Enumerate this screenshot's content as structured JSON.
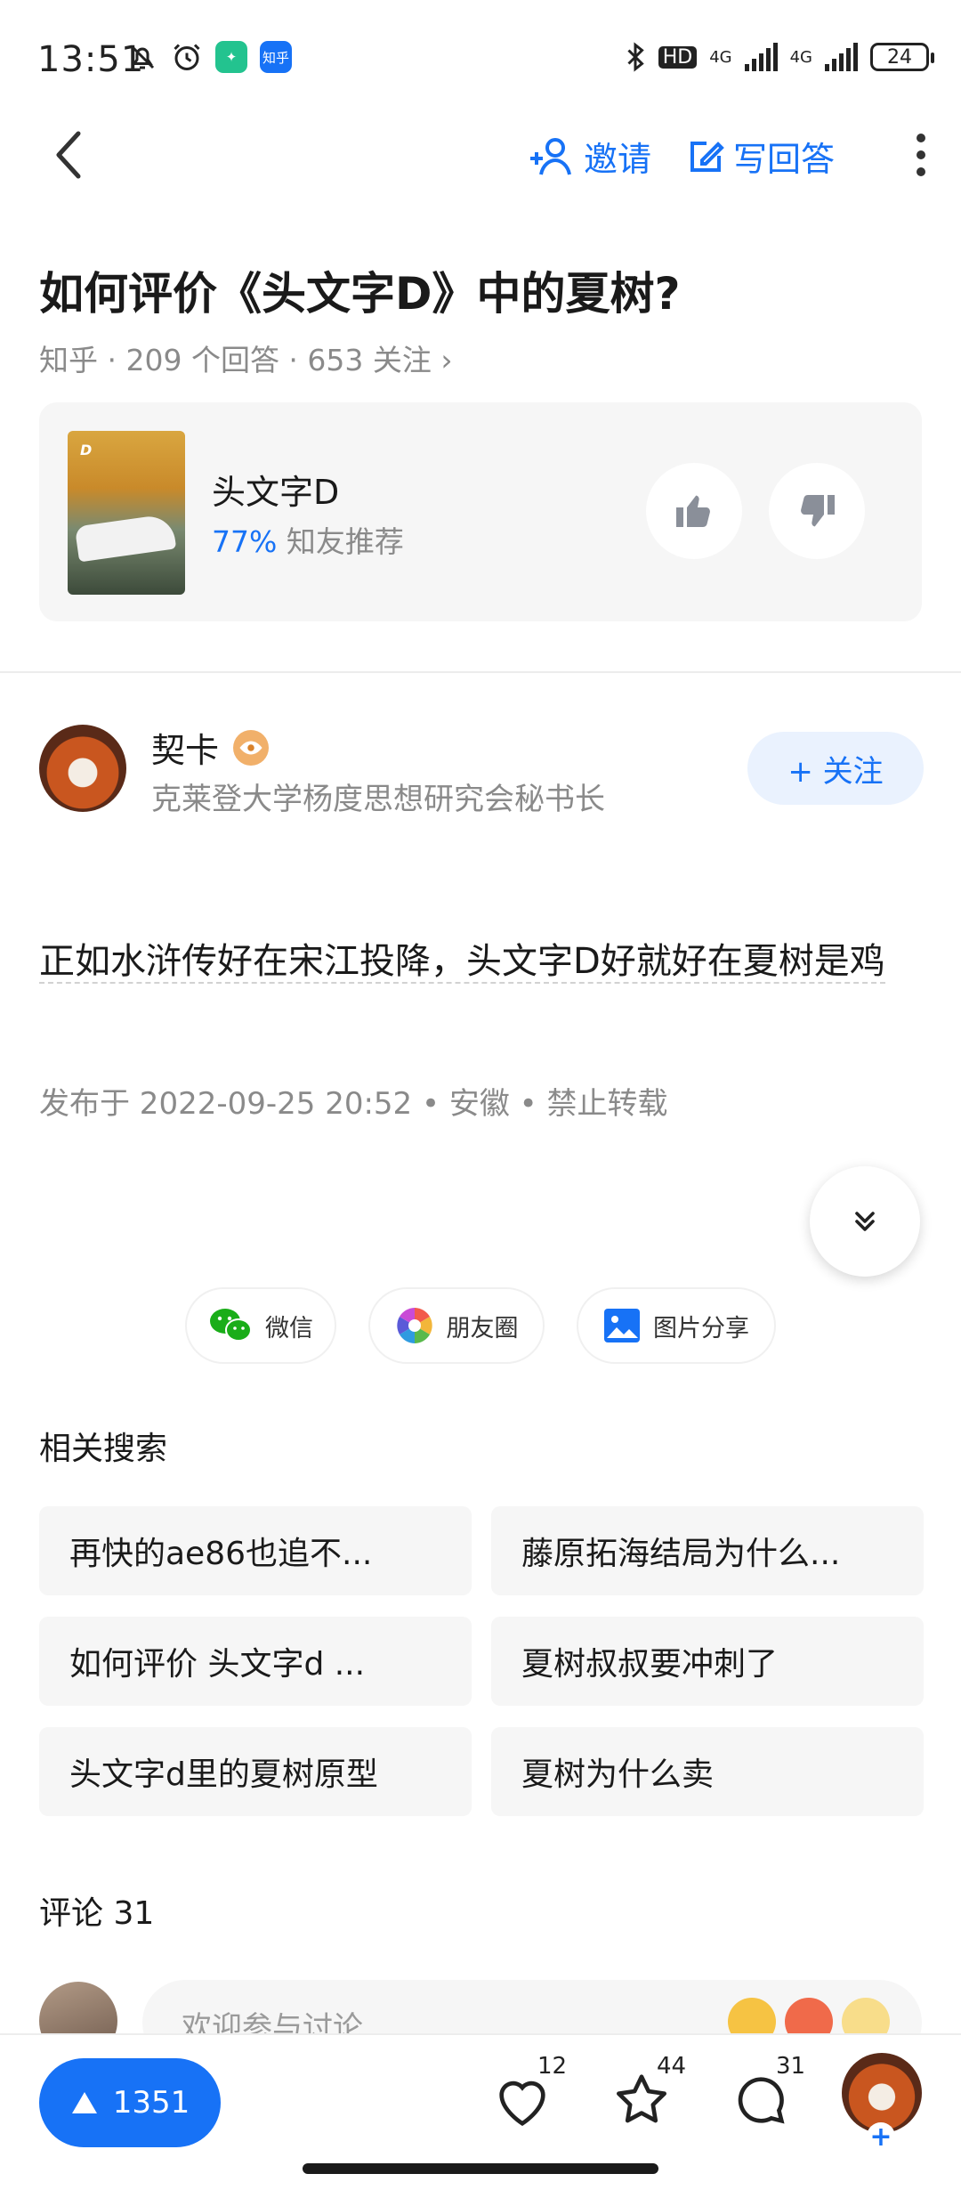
{
  "status_bar": {
    "time": "13:51",
    "network_1": "4G",
    "network_2": "4G",
    "hd_label": "HD",
    "battery": "24",
    "zhihu_app_label": "知乎"
  },
  "nav": {
    "invite_label": "邀请",
    "write_answer_label": "写回答"
  },
  "question": {
    "title": "如何评价《头文字D》中的夏树?",
    "meta": "知乎 · 209 个回答 · 653 关注 ›"
  },
  "movie_card": {
    "name": "头文字D",
    "recommend_pct": "77%",
    "recommend_label": " 知友推荐"
  },
  "author": {
    "name": "契卡",
    "description": "克莱登大学杨度思想研究会秘书长",
    "follow_label": "+ 关注"
  },
  "answer": {
    "text": "正如水浒传好在宋江投降，头文字D好就好在夏树是鸡",
    "meta": "发布于 2022-09-25 20:52 • 安徽 • 禁止转载"
  },
  "share": {
    "wechat": "微信",
    "moments": "朋友圈",
    "image_share": "图片分享"
  },
  "related": {
    "title": "相关搜索",
    "items": [
      "再快的ae86也追不...",
      "藤原拓海结局为什么...",
      "如何评价 头文字d ...",
      "夏树叔叔要冲刺了",
      "头文字d里的夏树原型",
      "夏树为什么卖"
    ]
  },
  "comments": {
    "title": "评论 31",
    "placeholder": "欢迎参与讨论"
  },
  "bottom_bar": {
    "upvotes": "1351",
    "likes": "12",
    "favorites": "44",
    "comments": "31"
  },
  "colors": {
    "accent": "#1772f6",
    "muted_text": "#8a8a8a",
    "card_bg": "#f6f6f6"
  }
}
